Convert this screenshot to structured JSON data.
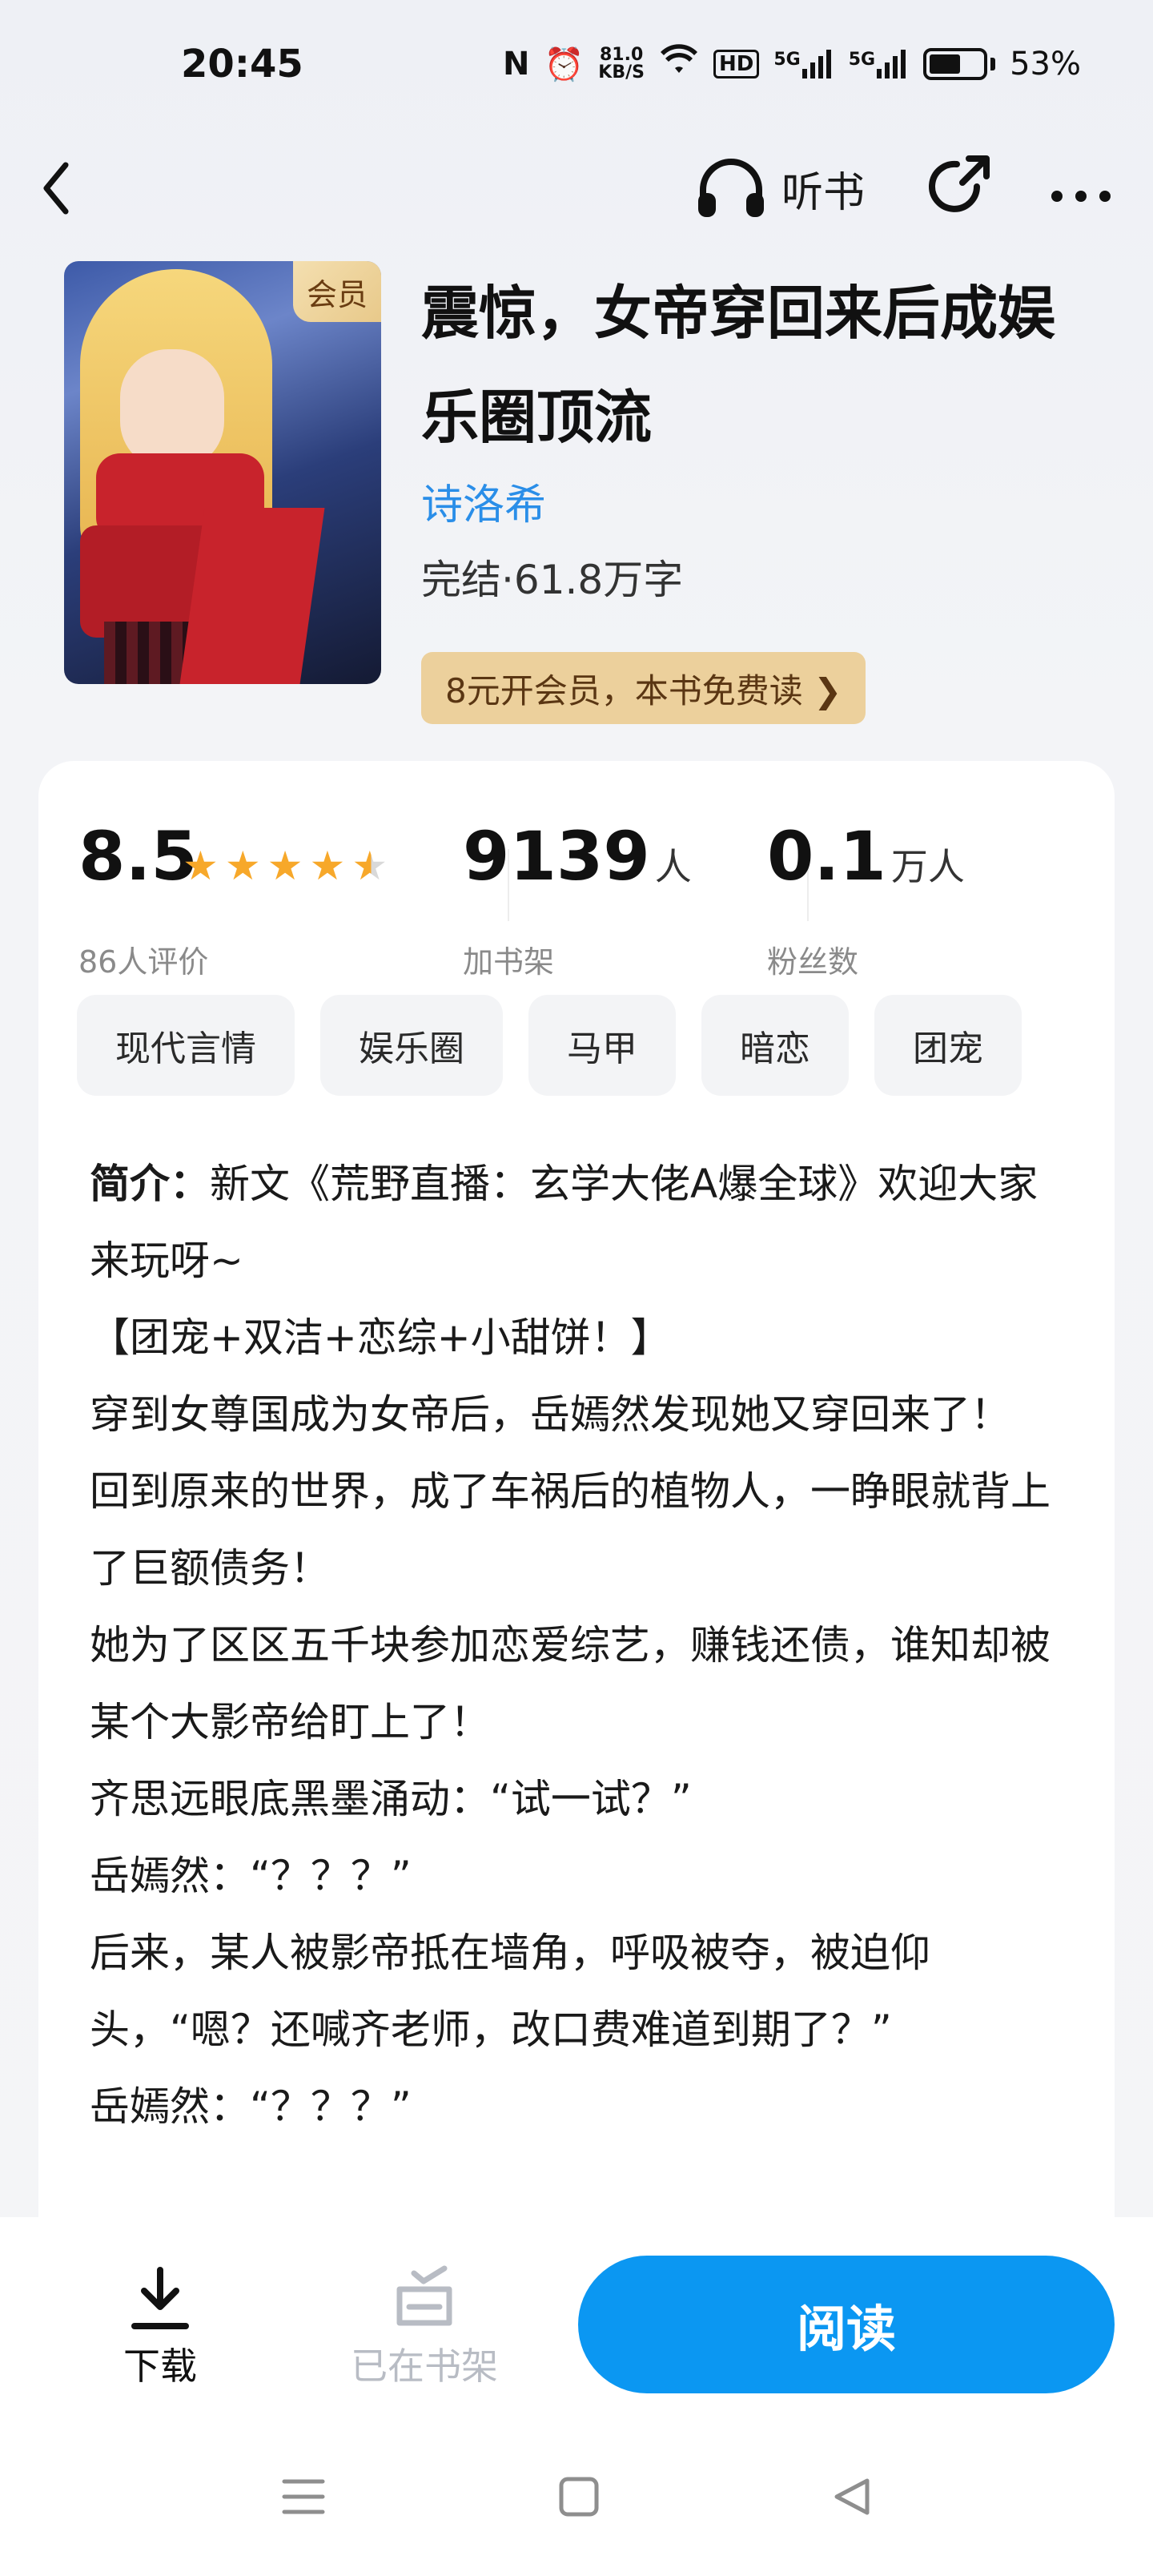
{
  "status_bar": {
    "time": "20:45",
    "net_speed_value": "81.0",
    "net_speed_unit": "KB/S",
    "hd_label": "HD",
    "signal1": "5G",
    "signal2": "5G",
    "battery": "53%"
  },
  "nav": {
    "listen_label": "听书"
  },
  "book": {
    "vip_badge": "会员",
    "title": "震惊，女帝穿回来后成娱乐圈顶流",
    "author": "诗洛希",
    "meta": "完结·61.8万字",
    "vip_promo": "8元开会员，本书免费读 ❯"
  },
  "stats": {
    "rating": "8.5",
    "rating_stars": 4.5,
    "rating_label": "86人评价",
    "shelf_count": "9139",
    "shelf_unit": "人",
    "shelf_label": "加书架",
    "fans_count": "0.1",
    "fans_unit": "万人",
    "fans_label": "粉丝数"
  },
  "tags": [
    "现代言情",
    "娱乐圈",
    "马甲",
    "暗恋",
    "团宠"
  ],
  "synopsis": {
    "label": "简介：",
    "first_line": "新文《荒野直播：玄学大佬A爆全球》欢迎大家来玩呀~",
    "lines": [
      "【团宠+双洁+恋综+小甜饼！】",
      "穿到女尊国成为女帝后，岳嫣然发现她又穿回来了！",
      "回到原来的世界，成了车祸后的植物人，一睁眼就背上了巨额债务！",
      "她为了区区五千块参加恋爱综艺，赚钱还债，谁知却被某个大影帝给盯上了！",
      "齐思远眼底黑墨涌动：“试一试？”",
      "岳嫣然：“？？？”",
      "后来，某人被影帝抵在墙角，呼吸被夺，被迫仰头，“嗯？还喊齐老师，改口费难道到期了？”",
      "岳嫣然：“？？？”"
    ]
  },
  "bottom": {
    "download_label": "下载",
    "shelf_label": "已在书架",
    "read_label": "阅读"
  },
  "colors": {
    "accent_blue": "#0b97f2",
    "author_blue": "#2a8ee8",
    "star_orange": "#f7a82a",
    "vip_gold": "#ecd09c"
  }
}
